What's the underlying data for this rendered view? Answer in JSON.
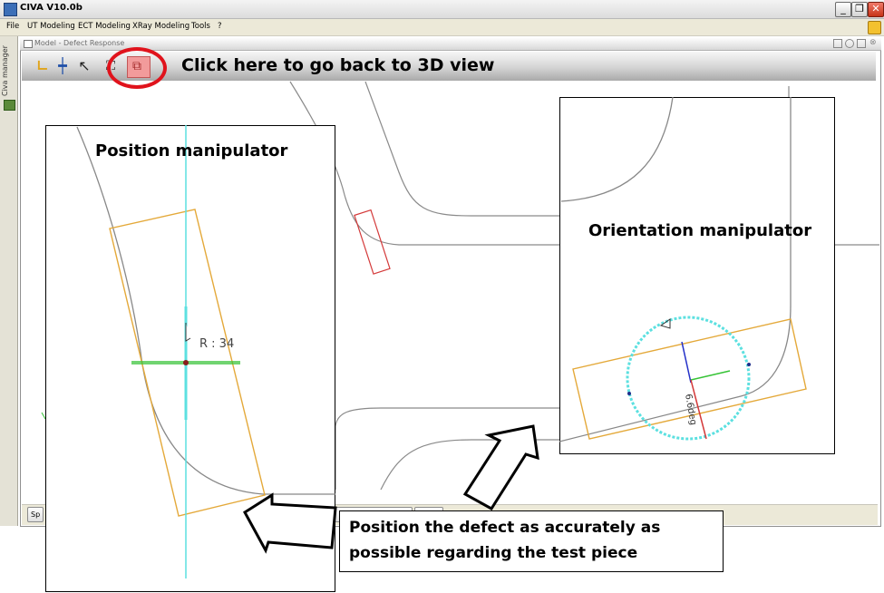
{
  "window": {
    "title": "CIVA V10.0b",
    "controls": {
      "minimize": "_",
      "restore": "❐",
      "close": "✕"
    }
  },
  "menu": [
    "File",
    "UT Modeling",
    "ECT Modeling",
    "XRay Modeling",
    "Tools",
    "?"
  ],
  "sidebar": {
    "label": "Civa manager"
  },
  "inner_window": {
    "title": "Model - Defect Response"
  },
  "toolbar": {
    "icons": [
      "axis-icon",
      "cross-section-icon",
      "pointer-icon",
      "fit-view-icon",
      "3d-view-icon"
    ],
    "callout": "Click here to go back to 3D view"
  },
  "status_buttons": [
    "Sp"
  ],
  "panels": {
    "position": {
      "title": "Position manipulator",
      "readout": "R : 34"
    },
    "orientation": {
      "title": "Orientation manipulator",
      "angle_label": "6.6deg"
    }
  },
  "note": {
    "line1": "Position the defect as accurately as",
    "line2": "possible regarding the test piece"
  },
  "colors": {
    "highlight": "#e0131c",
    "defect_box": "#e4a93a",
    "manipulator": "#5ce0e0",
    "red_defect": "#d43a3a"
  }
}
